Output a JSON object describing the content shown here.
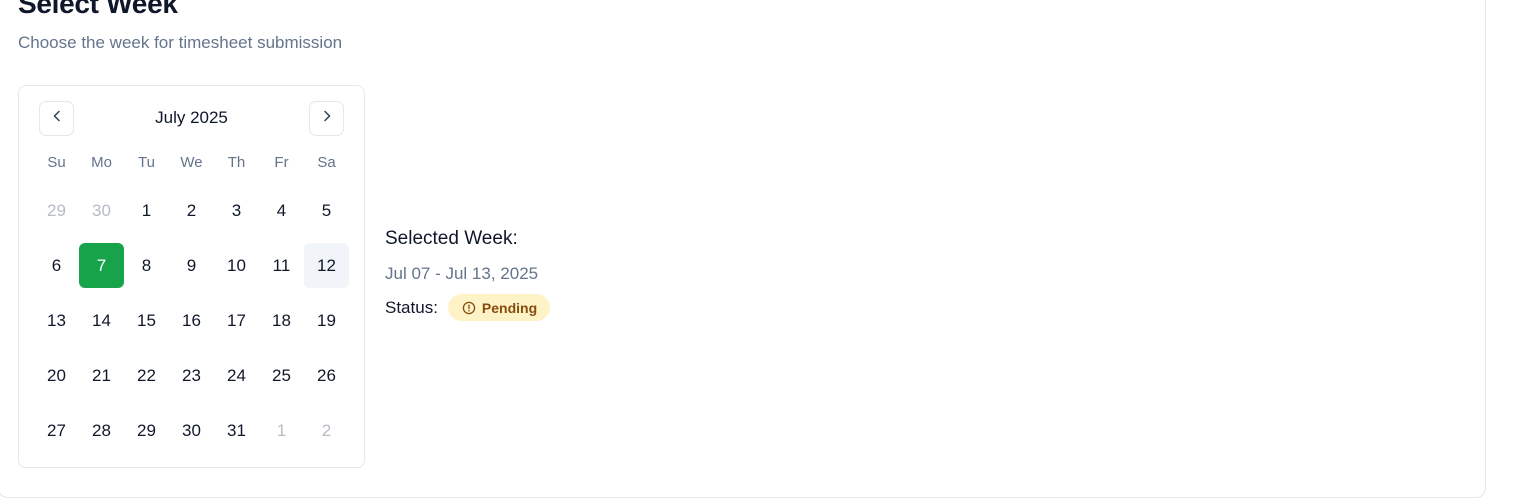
{
  "header": {
    "title": "Select Week",
    "subtitle": "Choose the week for timesheet submission"
  },
  "calendar": {
    "month_label": "July 2025",
    "prev_icon": "chevron-left-icon",
    "next_icon": "chevron-right-icon",
    "weekdays": [
      "Su",
      "Mo",
      "Tu",
      "We",
      "Th",
      "Fr",
      "Sa"
    ],
    "days": [
      {
        "label": "29",
        "outside": true
      },
      {
        "label": "30",
        "outside": true
      },
      {
        "label": "1"
      },
      {
        "label": "2"
      },
      {
        "label": "3"
      },
      {
        "label": "4"
      },
      {
        "label": "5"
      },
      {
        "label": "6"
      },
      {
        "label": "7",
        "selected": true
      },
      {
        "label": "8"
      },
      {
        "label": "9"
      },
      {
        "label": "10"
      },
      {
        "label": "11"
      },
      {
        "label": "12",
        "today": true
      },
      {
        "label": "13"
      },
      {
        "label": "14"
      },
      {
        "label": "15"
      },
      {
        "label": "16"
      },
      {
        "label": "17"
      },
      {
        "label": "18"
      },
      {
        "label": "19"
      },
      {
        "label": "20"
      },
      {
        "label": "21"
      },
      {
        "label": "22"
      },
      {
        "label": "23"
      },
      {
        "label": "24"
      },
      {
        "label": "25"
      },
      {
        "label": "26"
      },
      {
        "label": "27"
      },
      {
        "label": "28"
      },
      {
        "label": "29"
      },
      {
        "label": "30"
      },
      {
        "label": "31"
      },
      {
        "label": "1",
        "outside": true
      },
      {
        "label": "2",
        "outside": true
      }
    ]
  },
  "selection": {
    "heading": "Selected Week:",
    "range": "Jul 07 - Jul 13, 2025",
    "status_label": "Status:",
    "status_value": "Pending",
    "status_icon": "alert-circle-icon"
  },
  "colors": {
    "selected_day": "#16a34a",
    "today_day": "#f1f5f9",
    "badge_bg": "#fef3c7",
    "badge_text": "#854d0e",
    "muted_text": "#64748b"
  }
}
